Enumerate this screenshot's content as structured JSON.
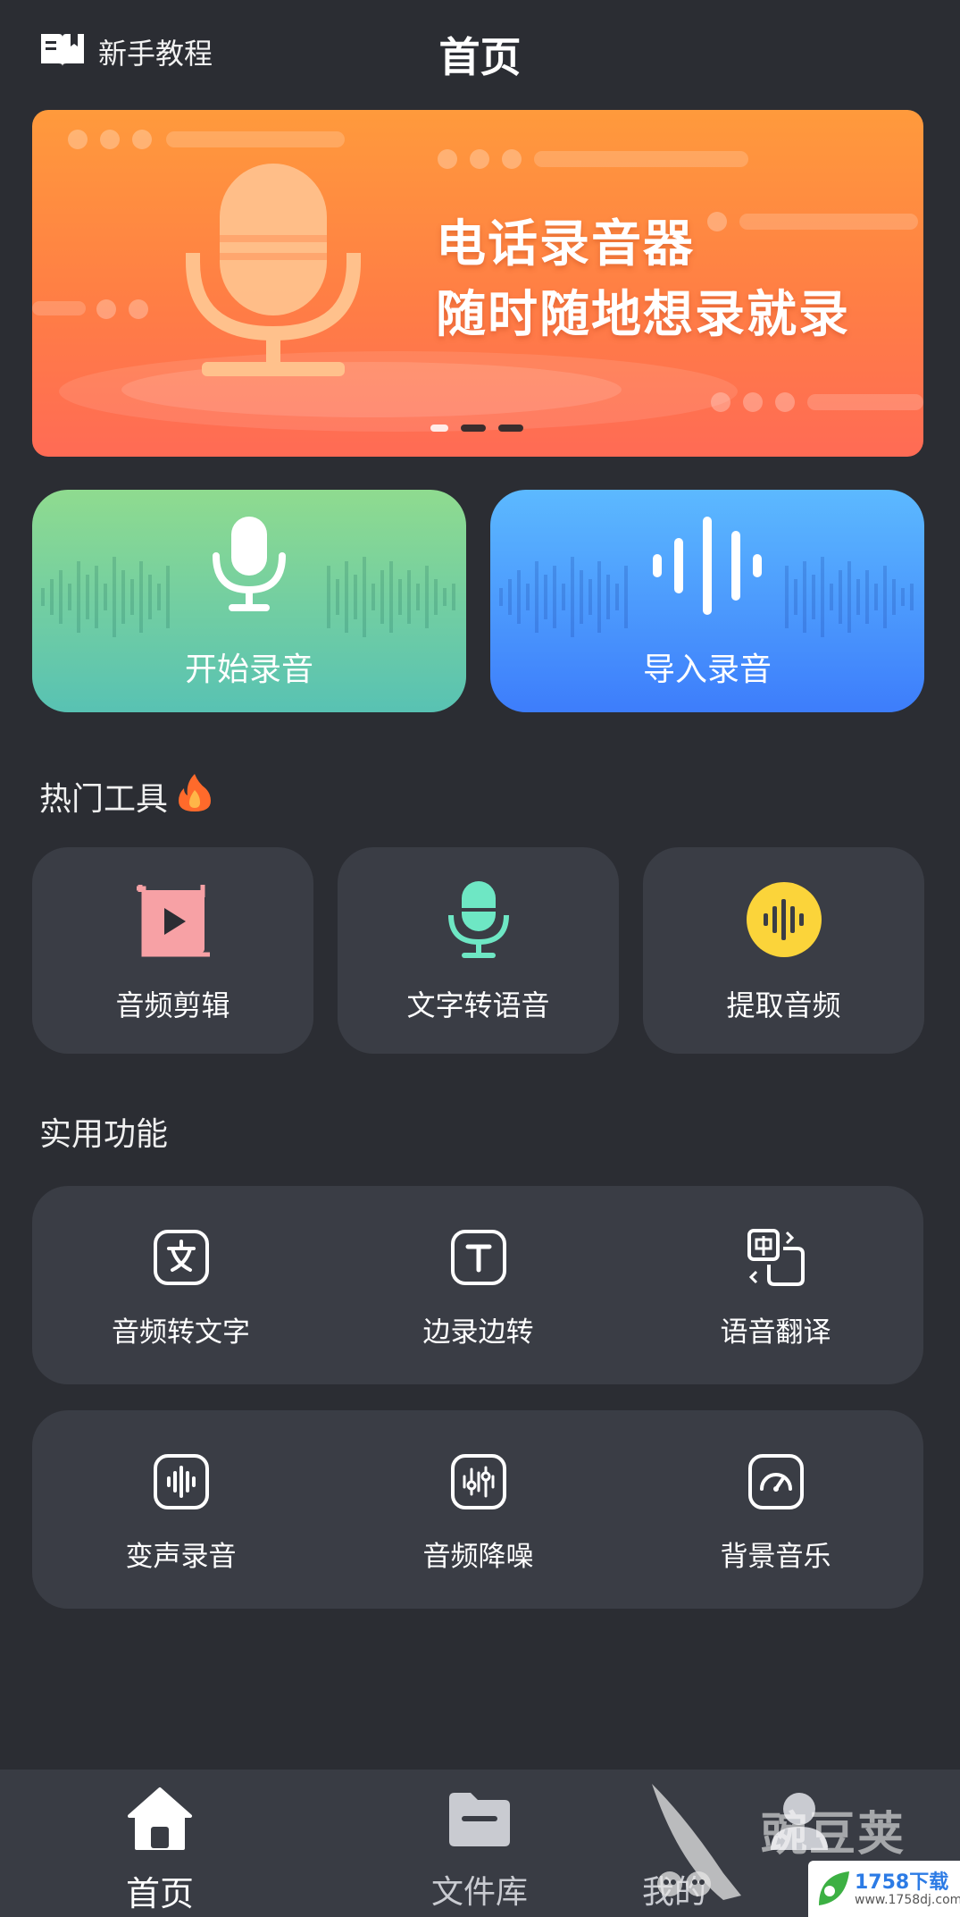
{
  "header": {
    "tutorial_label": "新手教程",
    "title": "首页"
  },
  "banner": {
    "line1": "电话录音器",
    "line2": "随时随地想录就录",
    "slide_count": 3,
    "active_slide": 1
  },
  "actions": {
    "record_label": "开始录音",
    "import_label": "导入录音"
  },
  "hot_tools": {
    "title": "热门工具",
    "items": [
      {
        "label": "音频剪辑",
        "icon": "audio-edit-icon"
      },
      {
        "label": "文字转语音",
        "icon": "tts-mic-icon"
      },
      {
        "label": "提取音频",
        "icon": "extract-audio-icon"
      }
    ]
  },
  "features": {
    "title": "实用功能",
    "row1": [
      {
        "label": "音频转文字",
        "icon": "text-char-icon"
      },
      {
        "label": "边录边转",
        "icon": "text-t-icon"
      },
      {
        "label": "语音翻译",
        "icon": "translate-icon"
      }
    ],
    "row2": [
      {
        "label": "变声录音",
        "icon": "voice-change-icon"
      },
      {
        "label": "音频降噪",
        "icon": "denoise-icon"
      },
      {
        "label": "背景音乐",
        "icon": "bgm-icon"
      }
    ]
  },
  "bottom_nav": {
    "items": [
      {
        "label": "首页",
        "icon": "home-icon",
        "active": true
      },
      {
        "label": "文件库",
        "icon": "folder-icon",
        "active": false
      },
      {
        "label": "我的",
        "icon": "profile-icon",
        "active": false
      }
    ]
  },
  "watermark": {
    "title": "豌豆荚",
    "badge_main": "1758下载",
    "badge_sub": "www.1758dj.com"
  },
  "colors": {
    "background": "#2b2d33",
    "card": "#3a3d45",
    "banner_orange": "#ff8a45",
    "record_green": "#6fcfa0",
    "import_blue": "#4a9cff",
    "tool_pink": "#f7a1a5",
    "tool_mint": "#6ee7c4",
    "tool_yellow": "#fbd43a"
  }
}
